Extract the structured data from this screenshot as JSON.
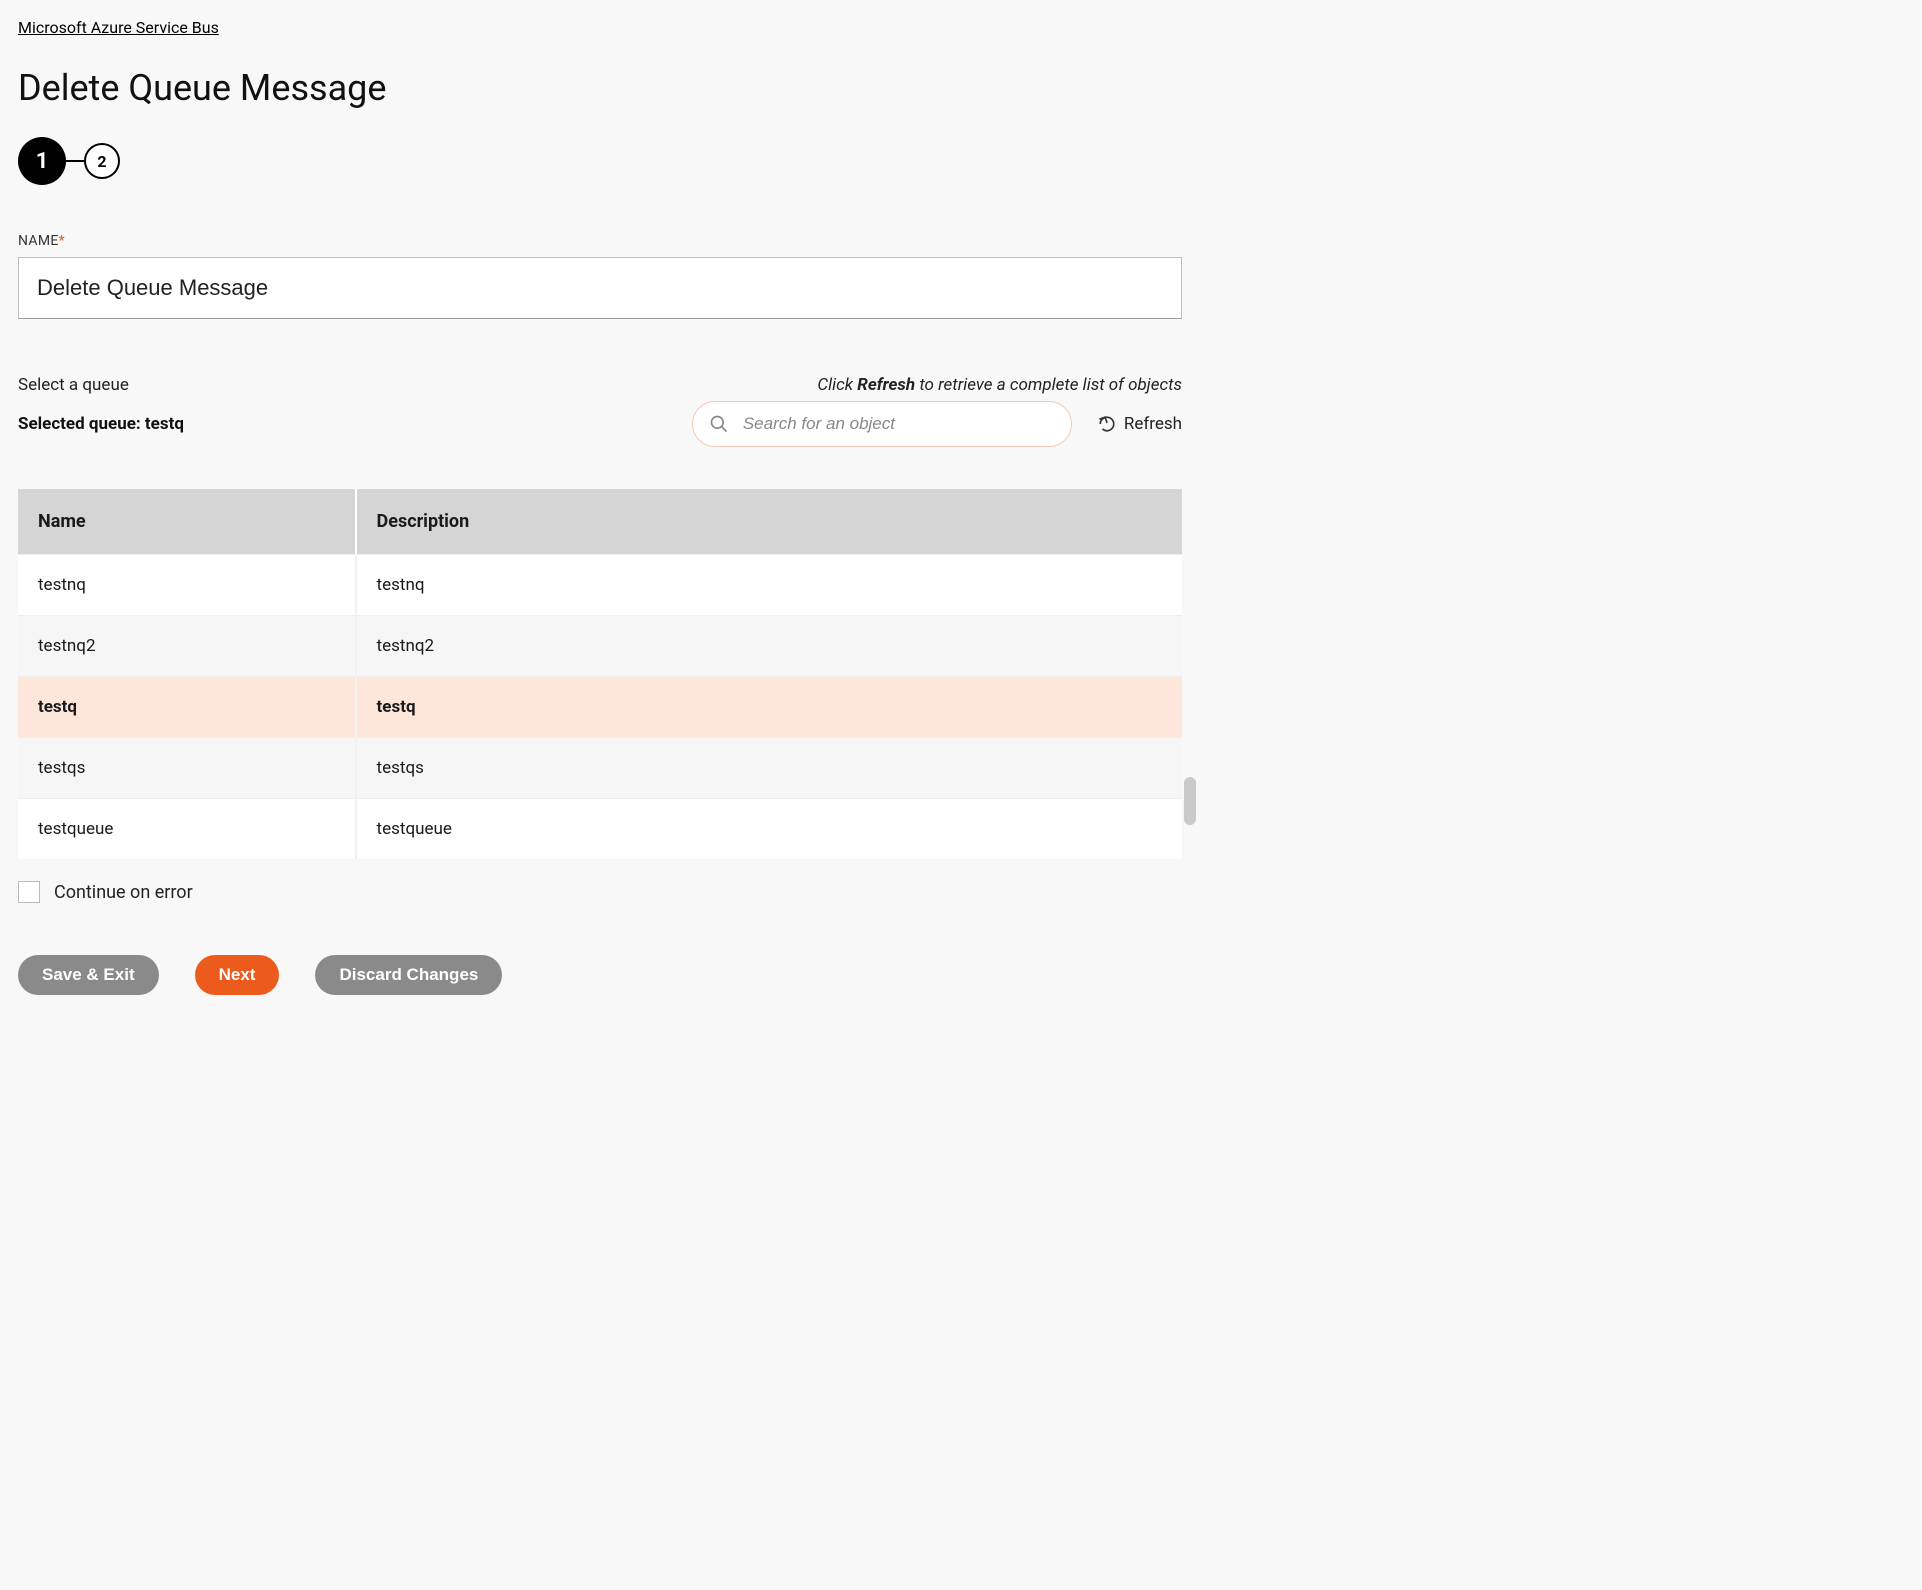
{
  "breadcrumb": "Microsoft Azure Service Bus",
  "title": "Delete Queue Message",
  "stepper": {
    "active": "1",
    "inactive": "2"
  },
  "name_field": {
    "label": "NAME",
    "required": "*",
    "value": "Delete Queue Message"
  },
  "select": {
    "label": "Select a queue",
    "hint_prefix": "Click ",
    "hint_bold": "Refresh",
    "hint_suffix": " to retrieve a complete list of objects",
    "selected_prefix": "Selected queue: ",
    "selected_value": "testq",
    "search_placeholder": "Search for an object",
    "refresh_label": "Refresh"
  },
  "table": {
    "headers": {
      "name": "Name",
      "description": "Description"
    },
    "rows": [
      {
        "name": "testnq",
        "description": "testnq",
        "selected": false,
        "alt": false
      },
      {
        "name": "testnq2",
        "description": "testnq2",
        "selected": false,
        "alt": true
      },
      {
        "name": "testq",
        "description": "testq",
        "selected": true,
        "alt": false
      },
      {
        "name": "testqs",
        "description": "testqs",
        "selected": false,
        "alt": true
      },
      {
        "name": "testqueue",
        "description": "testqueue",
        "selected": false,
        "alt": false
      }
    ]
  },
  "continue_on_error": {
    "label": "Continue on error",
    "checked": false
  },
  "buttons": {
    "save_exit": "Save & Exit",
    "next": "Next",
    "discard": "Discard Changes"
  }
}
